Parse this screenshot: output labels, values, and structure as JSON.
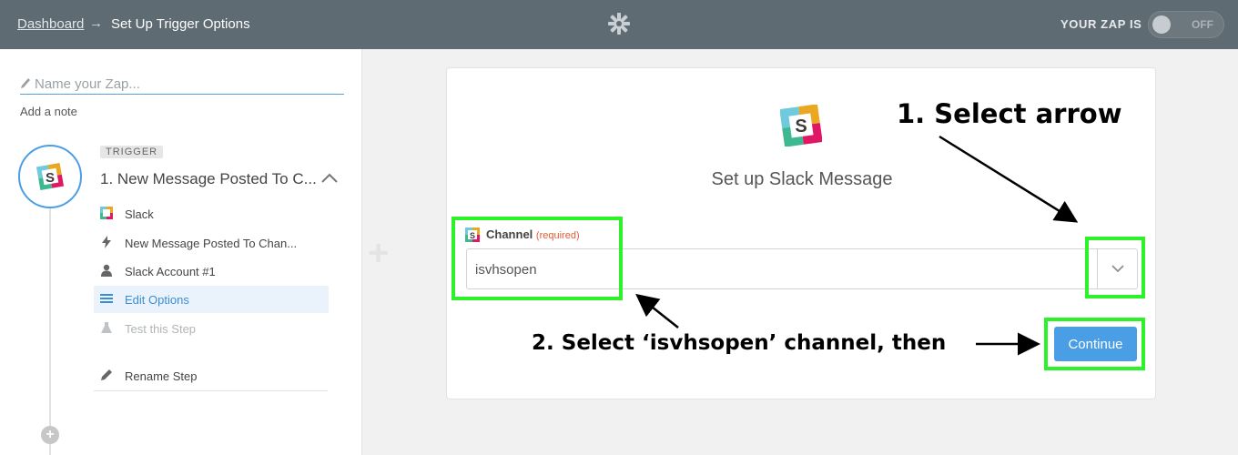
{
  "topbar": {
    "breadcrumb_link": "Dashboard",
    "breadcrumb_sep": "→",
    "breadcrumb_current": "Set Up Trigger Options",
    "zap_label": "YOUR ZAP IS",
    "toggle_state": "OFF"
  },
  "sidebar": {
    "zap_name_placeholder": "Name your Zap...",
    "add_note": "Add a note",
    "step": {
      "badge": "TRIGGER",
      "title": "1. New Message Posted To C...",
      "icon_letter": "S",
      "items": [
        {
          "label": "Slack",
          "icon": "slack-icon"
        },
        {
          "label": "New Message Posted To Chan...",
          "icon": "lightning-icon"
        },
        {
          "label": "Slack Account #1",
          "icon": "user-icon"
        },
        {
          "label": "Edit Options",
          "icon": "list-icon"
        },
        {
          "label": "Test this Step",
          "icon": "flask-icon"
        },
        {
          "label": "Rename Step",
          "icon": "pencil-icon"
        }
      ]
    },
    "add_step": "+"
  },
  "main": {
    "title": "Set up Slack Message",
    "channel_label": "Channel",
    "channel_required": "(required)",
    "channel_value": "isvhsopen",
    "continue_label": "Continue"
  },
  "annotations": {
    "step1": "1. Select arrow",
    "step2": "2. Select ‘isvhsopen’ channel, then"
  },
  "colors": {
    "topbar": "#5f6b73",
    "accent": "#4a9ee6",
    "highlight": "#2df22a",
    "required": "#e05c3a"
  }
}
